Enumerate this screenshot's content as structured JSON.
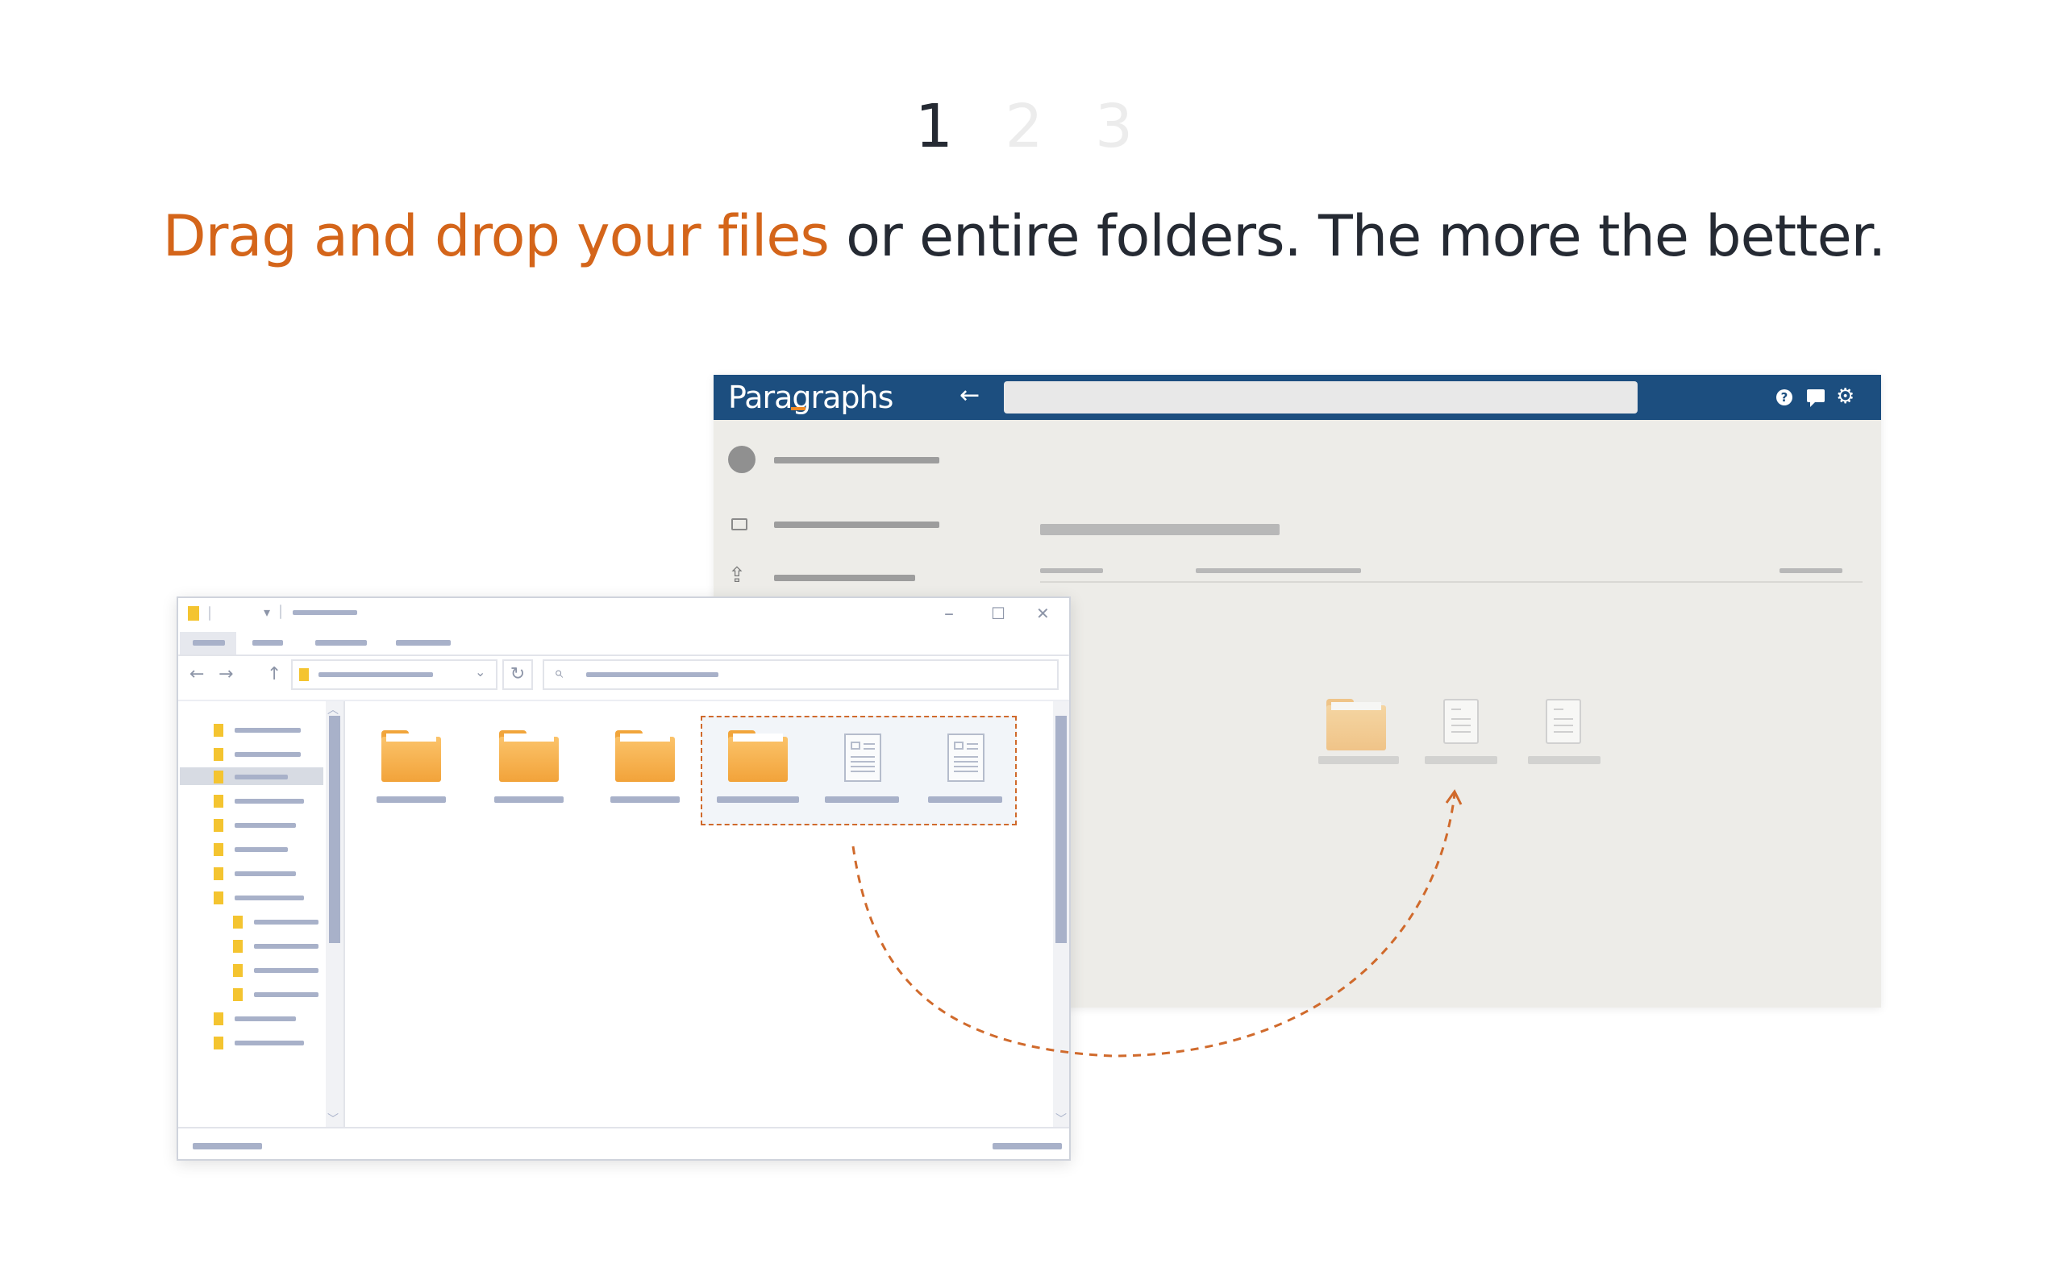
{
  "steps": {
    "step1": "1",
    "step2": "2",
    "step3": "3",
    "active": "1"
  },
  "headline": {
    "accent": "Drag and drop your files",
    "rest": " or entire folders. The more the better."
  },
  "paragraphs_app": {
    "logo": "Paragraphs",
    "back_icon": "arrow-left-icon",
    "icons": [
      "help-icon",
      "chat-icon",
      "gear-icon"
    ],
    "header_color": "#1c4e7f",
    "logo_accent_color": "#f08a24"
  },
  "explorer": {
    "window_controls": {
      "minimize": "–",
      "maximize": "☐",
      "close": "✕"
    }
  },
  "colors": {
    "accent": "#d4651a",
    "text": "#252a33",
    "drag_path": "#d06a2c"
  }
}
